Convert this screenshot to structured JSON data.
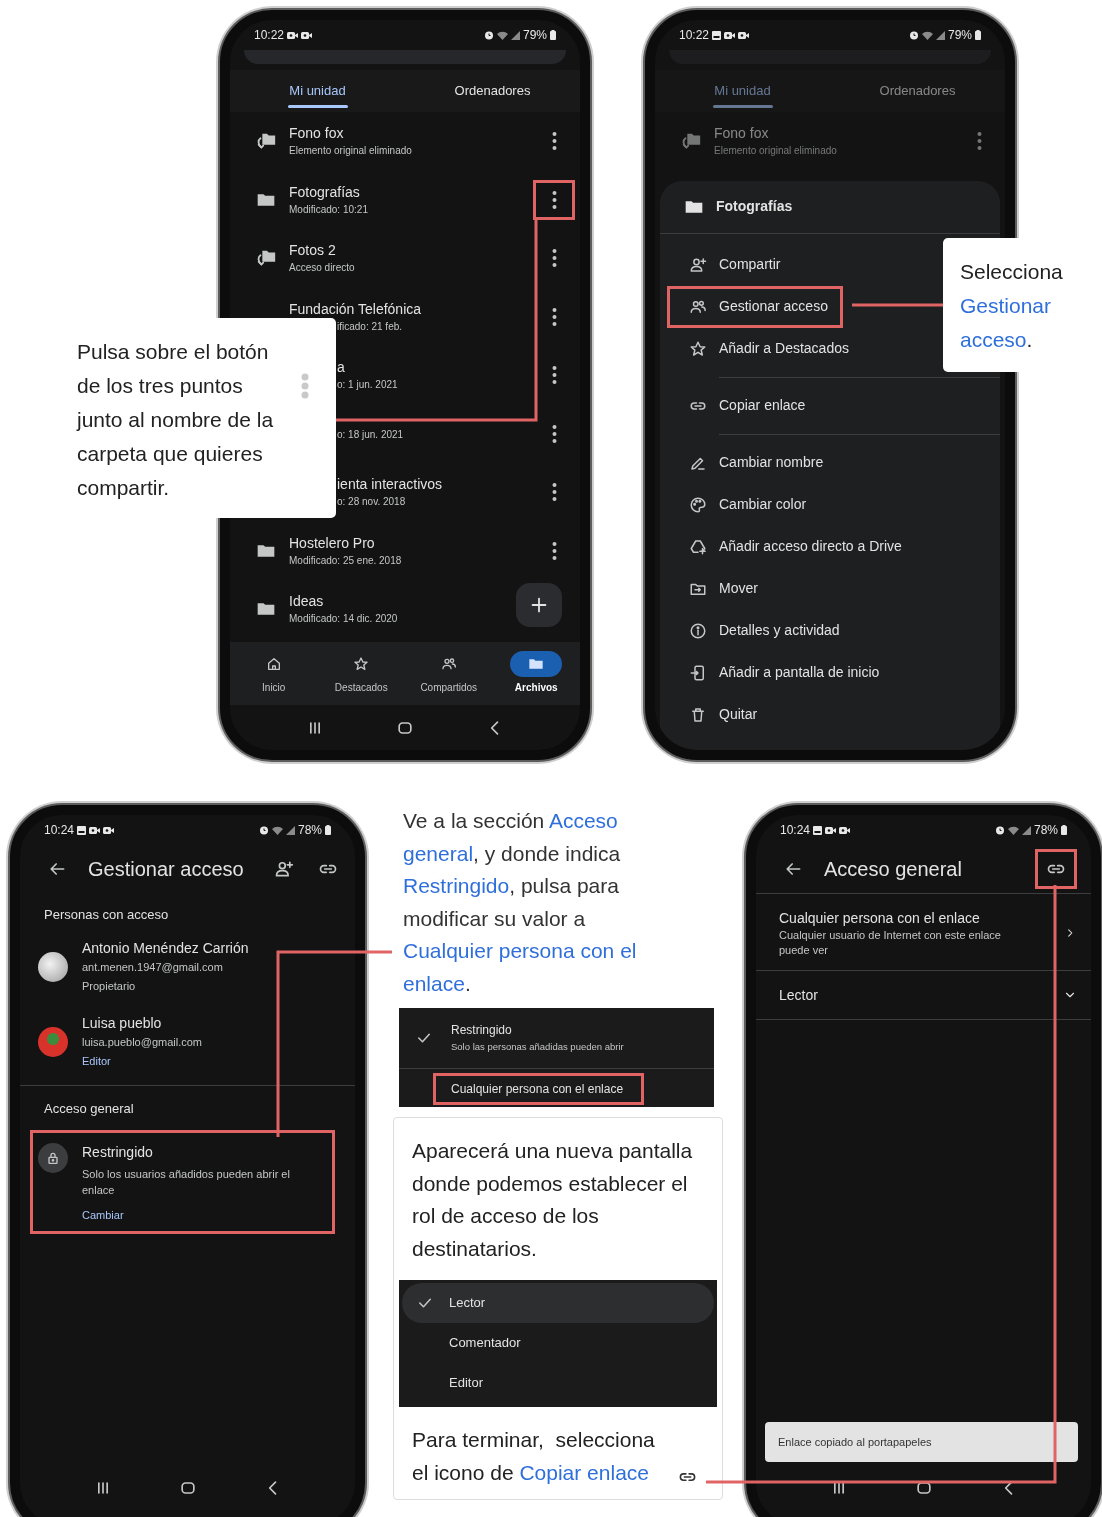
{
  "drive_screen": {
    "status_bar": {
      "time": "10:22",
      "battery": "79%"
    },
    "tabs": [
      {
        "label": "Mi unidad",
        "selected": true
      },
      {
        "label": "Ordenadores",
        "selected": false
      }
    ],
    "files": [
      {
        "kind": "shortcut",
        "name": "Fono fox",
        "detail": "Elemento original eliminado",
        "name_covered": false,
        "detail_covered": false,
        "menu": true,
        "menu_highlighted": false
      },
      {
        "kind": "folder",
        "name": "Fotografías",
        "detail": "Modificado: 10:21",
        "name_covered": false,
        "detail_covered": false,
        "menu": true,
        "menu_highlighted": true
      },
      {
        "kind": "shortcut",
        "name": "Fotos 2",
        "detail": "Acceso directo",
        "name_covered": false,
        "detail_covered": false,
        "menu": true,
        "menu_highlighted": false
      },
      {
        "name": "Fundación Telefónica",
        "detail": "ificado: 21 feb.",
        "name_covered": false,
        "detail_covered": true,
        "menu": true,
        "menu_highlighted": false
      },
      {
        "name": "a",
        "detail": "o: 1 jun. 2021",
        "name_covered": true,
        "detail_covered": true,
        "menu": true,
        "menu_highlighted": false
      },
      {
        "detail": "o: 18 jun. 2021",
        "detail_covered": true,
        "menu": true,
        "menu_highlighted": false
      },
      {
        "name": "ienta interactivos",
        "detail": "o: 28 nov. 2018",
        "name_covered": true,
        "detail_covered": true,
        "menu": true,
        "menu_highlighted": false
      },
      {
        "kind": "folder",
        "name": "Hostelero Pro",
        "detail": "Modificado: 25 ene. 2018",
        "name_covered": false,
        "detail_covered": false,
        "menu": true,
        "menu_highlighted": false
      },
      {
        "kind": "folder",
        "name": "Ideas",
        "detail": "Modificado: 14 dic. 2020",
        "menu": false
      }
    ],
    "bottom_nav": [
      {
        "label": "Inicio",
        "selected": false
      },
      {
        "label": "Destacados",
        "selected": false
      },
      {
        "label": "Compartidos",
        "selected": false
      },
      {
        "label": "Archivos",
        "selected": true
      }
    ],
    "callout": [
      "Pulsa sobre el botón de los tres puntos",
      "junto al nombre de la carpeta que quieres compartir."
    ]
  },
  "menu_screen": {
    "status_bar": {
      "time": "10:22",
      "battery": "79%"
    },
    "scrim": true,
    "tabs": [
      {
        "label": "Mi unidad",
        "selected": true
      },
      {
        "label": "Ordenadores",
        "selected": false
      }
    ],
    "file": {
      "kind": "shortcut",
      "name": "Fono fox",
      "detail": "Elemento original eliminado"
    },
    "sheet": {
      "title": "Fotografías",
      "items": [
        {
          "label": "Compartir",
          "highlighted": false,
          "divider_after": false
        },
        {
          "label": "Gestionar acceso",
          "highlighted": true,
          "divider_after": false
        },
        {
          "label": "Añadir a Destacados",
          "highlighted": false,
          "divider_after": true
        },
        {
          "label": "Copiar enlace",
          "highlighted": false,
          "divider_after": true
        },
        {
          "label": "Cambiar nombre",
          "highlighted": false,
          "divider_after": false
        },
        {
          "label": "Cambiar color",
          "highlighted": false,
          "divider_after": false
        },
        {
          "label": "Añadir acceso directo a Drive",
          "highlighted": false,
          "divider_after": false
        },
        {
          "label": "Mover",
          "highlighted": false,
          "divider_after": false
        },
        {
          "label": "Detalles y actividad",
          "highlighted": false,
          "divider_after": false
        },
        {
          "label": "Añadir a pantalla de inicio",
          "highlighted": false,
          "divider_after": false
        },
        {
          "label": "Quitar",
          "highlighted": false,
          "divider_after": false
        }
      ]
    },
    "callout": "Selecciona **Gestionar acceso**."
  },
  "access_screen": {
    "status_bar": {
      "time": "10:24",
      "battery": "78%"
    },
    "title": "Gestionar acceso",
    "people_heading": "Personas con acceso",
    "people": [
      {
        "name": "Antonio Menéndez Carrión",
        "email": "ant.menen.1947@gmail.com",
        "role": "Propietario",
        "role_link": false
      },
      {
        "name": "Luisa pueblo",
        "email": "luisa.pueblo@gmail.com",
        "role": "Editor",
        "role_link": true
      }
    ],
    "general_heading": "Acceso general",
    "general": {
      "title": "Restringido",
      "description": "Solo los usuarios añadidos pueden abrir el enlace",
      "action": "Cambiar",
      "highlighted": true
    }
  },
  "instructions": {
    "intro": "Ve a la sección **Acceso general**, y donde indica **Restringido**, pulsa para modificar su valor a **Cualquier persona con el enlace**.",
    "access_options": [
      {
        "label": "Restringido",
        "description": "Solo las personas añadidas pueden abrir",
        "selected": true,
        "highlighted": false
      },
      {
        "label": "Cualquier persona con el enlace",
        "selected": false,
        "highlighted": true
      }
    ],
    "role_text": "Aparecerá una nueva pantalla donde podemos establecer el rol de acceso de los destinatarios.",
    "roles": [
      {
        "label": "Lector",
        "selected": true
      },
      {
        "label": "Comentador",
        "selected": false
      },
      {
        "label": "Editor",
        "selected": false
      }
    ],
    "final_text": "Para terminar,  selecciona el icono de **Copiar enlace**"
  },
  "general_screen": {
    "status_bar": {
      "time": "10:24",
      "battery": "78%"
    },
    "title": "Acceso general",
    "link_highlighted": true,
    "access": {
      "title": "Cualquier persona con el enlace",
      "description": "Cualquier usuario de Internet con este enlace puede ver"
    },
    "role": "Lector",
    "snackbar": "Enlace copiado al portapapeles"
  }
}
